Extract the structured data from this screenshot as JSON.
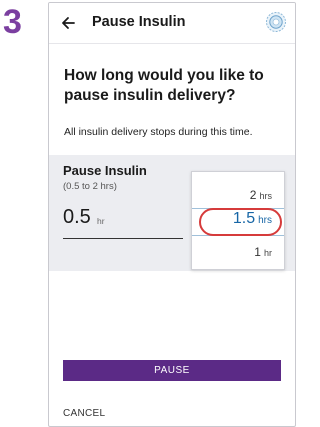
{
  "step": "3",
  "header": {
    "title": "Pause Insulin"
  },
  "question": "How long would you like to pause insulin delivery?",
  "info": "All insulin delivery stops during this time.",
  "panel": {
    "label": "Pause Insulin",
    "range": "(0.5 to 2 hrs)",
    "value": "0.5",
    "unit": "hr"
  },
  "picker": {
    "options": [
      {
        "value": "2",
        "unit": "hrs"
      },
      {
        "value": "1.5",
        "unit": "hrs",
        "selected": true
      },
      {
        "value": "1",
        "unit": "hr"
      }
    ]
  },
  "actions": {
    "pause_label": "PAUSE",
    "cancel_label": "CANCEL"
  },
  "colors": {
    "step_number": "#7b3fa0",
    "primary_button": "#5b2a86",
    "selected_value": "#1766a6",
    "highlight_ring": "#d63b3b",
    "panel_background": "#ecedf1"
  }
}
